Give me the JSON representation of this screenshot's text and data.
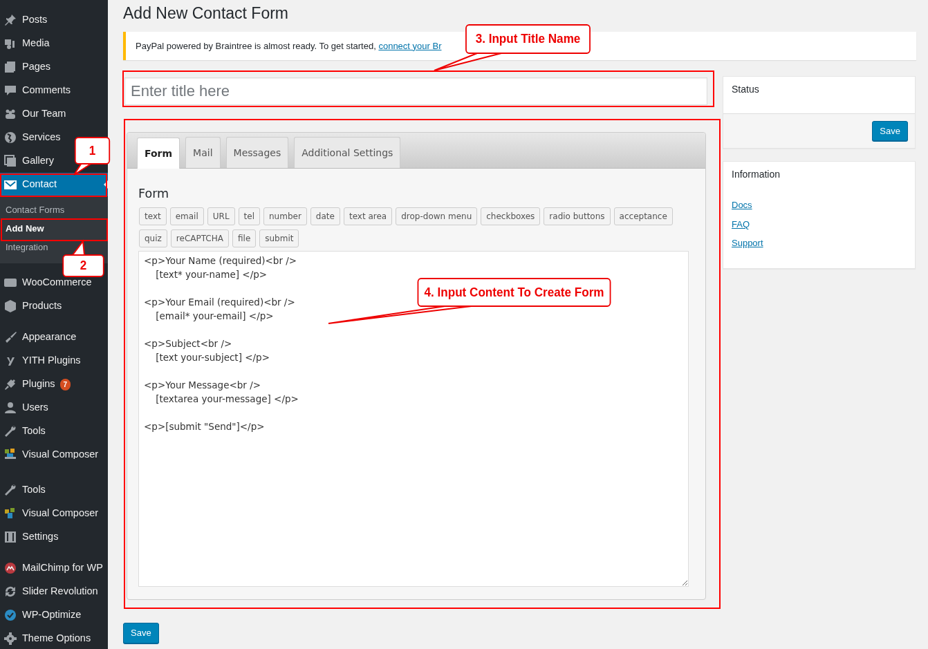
{
  "sidebar": {
    "items": [
      {
        "label": "Posts",
        "selected": false
      },
      {
        "label": "Media",
        "selected": false
      },
      {
        "label": "Pages",
        "selected": false
      },
      {
        "label": "Comments",
        "selected": false
      },
      {
        "label": "Our Team",
        "selected": false
      },
      {
        "label": "Services",
        "selected": false
      },
      {
        "label": "Gallery",
        "selected": false
      },
      {
        "label": "Contact",
        "selected": true,
        "children": [
          {
            "label": "Contact Forms",
            "selected": false
          },
          {
            "label": "Add New",
            "selected": true
          },
          {
            "label": "Integration",
            "selected": false
          }
        ]
      },
      {
        "label": "WooCommerce",
        "selected": false
      },
      {
        "label": "Products",
        "selected": false
      },
      {
        "label": "Appearance",
        "selected": false,
        "gap_before": true
      },
      {
        "label": "YITH Plugins",
        "selected": false
      },
      {
        "label": "Plugins",
        "selected": false,
        "badge": "7"
      },
      {
        "label": "Users",
        "selected": false
      },
      {
        "label": "Tools",
        "selected": false
      },
      {
        "label": "Visual Composer",
        "selected": false,
        "clipped": true
      },
      {
        "label": "Tools",
        "selected": false
      },
      {
        "label": "Visual Composer",
        "selected": false
      },
      {
        "label": "Settings",
        "selected": false
      },
      {
        "label": "MailChimp for WP",
        "selected": false,
        "gap_before": true
      },
      {
        "label": "Slider Revolution",
        "selected": false
      },
      {
        "label": "WP-Optimize",
        "selected": false
      },
      {
        "label": "Theme Options",
        "selected": false
      }
    ]
  },
  "page_title": "Add New Contact Form",
  "notice": {
    "text": "PayPal powered by Braintree is almost ready. To get started, ",
    "link": "connect your Br"
  },
  "title_field": {
    "placeholder": "Enter title here"
  },
  "tabs": [
    {
      "label": "Form",
      "selected": true
    },
    {
      "label": "Mail",
      "selected": false
    },
    {
      "label": "Messages",
      "selected": false
    },
    {
      "label": "Additional Settings",
      "selected": false
    }
  ],
  "form_panel": {
    "heading": "Form",
    "tag_buttons": [
      "text",
      "email",
      "URL",
      "tel",
      "number",
      "date",
      "text area",
      "drop-down menu",
      "checkboxes",
      "radio buttons",
      "acceptance",
      "quiz",
      "reCAPTCHA",
      "file",
      "submit"
    ],
    "content": "<p>Your Name (required)<br />\n    [text* your-name] </p>\n\n<p>Your Email (required)<br />\n    [email* your-email] </p>\n\n<p>Subject<br />\n    [text your-subject] </p>\n\n<p>Your Message<br />\n    [textarea your-message] </p>\n\n<p>[submit \"Send\"]</p>"
  },
  "save_button": "Save",
  "status_box": {
    "title": "Status",
    "button": "Save"
  },
  "information_box": {
    "title": "Information",
    "links": [
      "Docs",
      "FAQ",
      "Support"
    ]
  },
  "callouts": [
    {
      "label": "1"
    },
    {
      "label": "2"
    },
    {
      "label": "3. Input Title Name"
    },
    {
      "label": "4. Input Content To Create Form"
    }
  ]
}
